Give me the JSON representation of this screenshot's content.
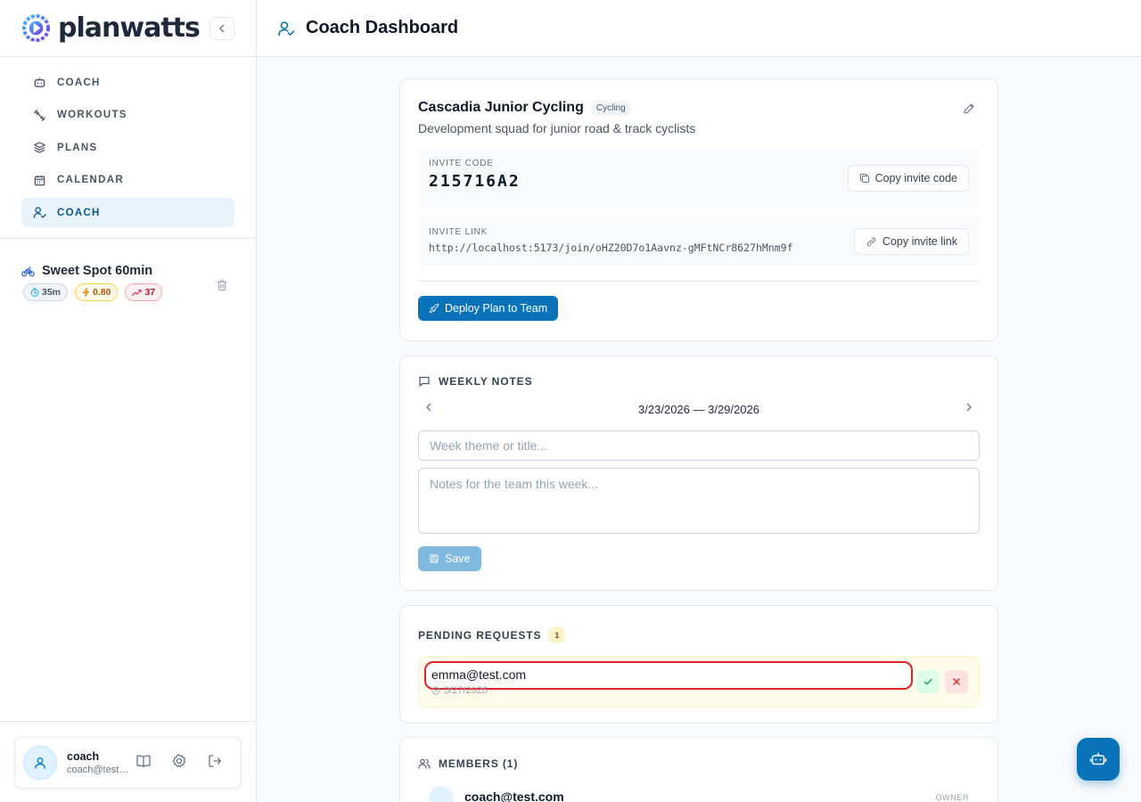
{
  "brand": {
    "name": "planwatts"
  },
  "nav": {
    "items": [
      {
        "label": "COACH",
        "icon": "robot-icon"
      },
      {
        "label": "WORKOUTS",
        "icon": "dumbbell-icon"
      },
      {
        "label": "PLANS",
        "icon": "layers-icon"
      },
      {
        "label": "CALENDAR",
        "icon": "calendar-icon"
      },
      {
        "label": "COACH",
        "icon": "user-check-icon",
        "active": true
      }
    ]
  },
  "workout": {
    "title": "Sweet Spot 60min",
    "duration": "35m",
    "intensity": "0.80",
    "tss": "37"
  },
  "user": {
    "name": "coach",
    "email": "coach@test.com"
  },
  "header": {
    "title": "Coach Dashboard"
  },
  "team": {
    "name": "Cascadia Junior Cycling",
    "sport": "Cycling",
    "description": "Development squad for junior road & track cyclists",
    "invite_code_label": "INVITE CODE",
    "invite_code": "215716A2",
    "copy_code_label": "Copy invite code",
    "invite_link_label": "INVITE LINK",
    "invite_link": "http://localhost:5173/join/oHZ20D7o1Aavnz-gMFtNCr8627hMnm9f",
    "copy_link_label": "Copy invite link",
    "deploy_label": "Deploy Plan to Team"
  },
  "notes": {
    "title": "WEEKLY NOTES",
    "week_range": "3/23/2026 — 3/29/2026",
    "theme_placeholder": "Week theme or title...",
    "notes_placeholder": "Notes for the team this week...",
    "save_label": "Save"
  },
  "pending": {
    "title": "PENDING REQUESTS",
    "count": "1",
    "requests": [
      {
        "email": "emma@test.com",
        "date": "3/27/2026"
      }
    ]
  },
  "members": {
    "title": "MEMBERS (1)",
    "list": [
      {
        "email": "coach@test.com",
        "role": "OWNER"
      }
    ]
  },
  "colors": {
    "accent": "#0873b8",
    "active_nav_bg": "#e8f3fc",
    "highlight": "#dc2626"
  }
}
